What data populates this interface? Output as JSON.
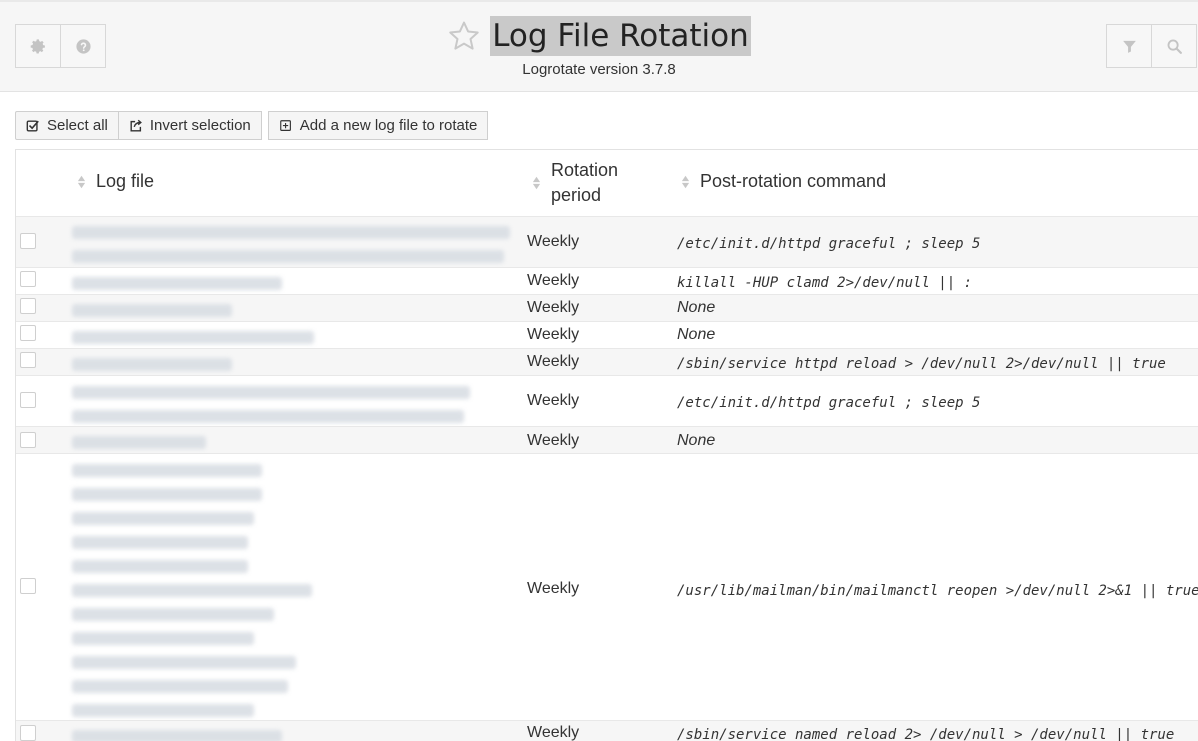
{
  "header": {
    "title": "Log File Rotation",
    "subtitle": "Logrotate version 3.7.8"
  },
  "toolbar": {
    "select_all": "Select all",
    "invert": "Invert selection",
    "add": "Add a new log file to rotate"
  },
  "table": {
    "col_logfile": "Log file",
    "col_period_1": "Rotation",
    "col_period_2": "period",
    "col_command": "Post-rotation command",
    "rows": [
      {
        "period": "Weekly",
        "command": "/etc/init.d/httpd graceful ; sleep 5"
      },
      {
        "period": "Weekly",
        "command": "killall -HUP clamd 2>/dev/null || :"
      },
      {
        "period": "Weekly",
        "command": "None"
      },
      {
        "period": "Weekly",
        "command": "None"
      },
      {
        "period": "Weekly",
        "command": "/sbin/service httpd reload > /dev/null 2>/dev/null || true"
      },
      {
        "period": "Weekly",
        "command": "/etc/init.d/httpd graceful ; sleep 5"
      },
      {
        "period": "Weekly",
        "command": "None"
      },
      {
        "period": "Weekly",
        "command": "/usr/lib/mailman/bin/mailmanctl reopen >/dev/null 2>&1 || true"
      },
      {
        "period": "Weekly",
        "command": "/sbin/service named reload 2> /dev/null > /dev/null || true"
      }
    ]
  }
}
